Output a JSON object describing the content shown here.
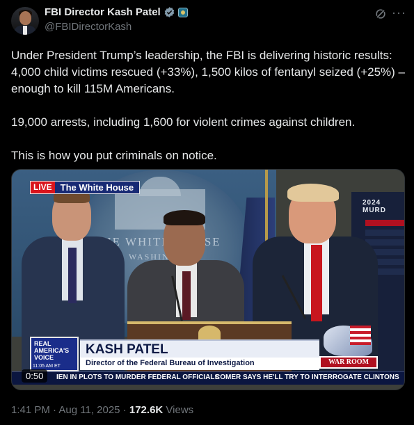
{
  "author": {
    "display_name": "FBI Director Kash Patel",
    "handle": "@FBIDirectorKash"
  },
  "tweet": {
    "paragraphs": [
      "Under President Trump’s leadership, the FBI is delivering historic results: 4,000 child victims rescued (+33%), 1,500 kilos of fentanyl seized (+25%) – enough to kill 115M Americans.",
      "19,000 arrests, including 1,600 for violent crimes against children.",
      "This is how you put criminals on notice."
    ]
  },
  "video": {
    "live_label": "LIVE",
    "location_label": "The White House",
    "backdrop_text_1": "THE WHITE HOUSE",
    "backdrop_text_2": "WASHINGTON",
    "screen_title": "2024 MURD",
    "network_logo": "REAL AMERICA'S VOICE",
    "time_label": "11:05 AM ET",
    "chyron_name": "KASH PATEL",
    "chyron_title": "Director of the Federal Bureau of Investigation",
    "show_logo": "WAR ROOM",
    "ticker_left": "IEN IN PLOTS TO MURDER FEDERAL OFFICIALS",
    "ticker_right": "COMER SAYS HE'LL TRY TO INTERROGATE CLINTONS",
    "duration": "0:50"
  },
  "meta": {
    "time": "1:41 PM",
    "separator": "·",
    "date": "Aug 11, 2025",
    "views_count": "172.6K",
    "views_label": "Views"
  },
  "icons": {
    "verified": "verified-badge-icon",
    "affiliation": "fbi-affiliation-icon",
    "grok": "grok-icon",
    "more": "more-icon"
  },
  "colors": {
    "background": "#000000",
    "text": "#e7e9ea",
    "secondary": "#71767b",
    "verified": "#1d9bf0"
  }
}
